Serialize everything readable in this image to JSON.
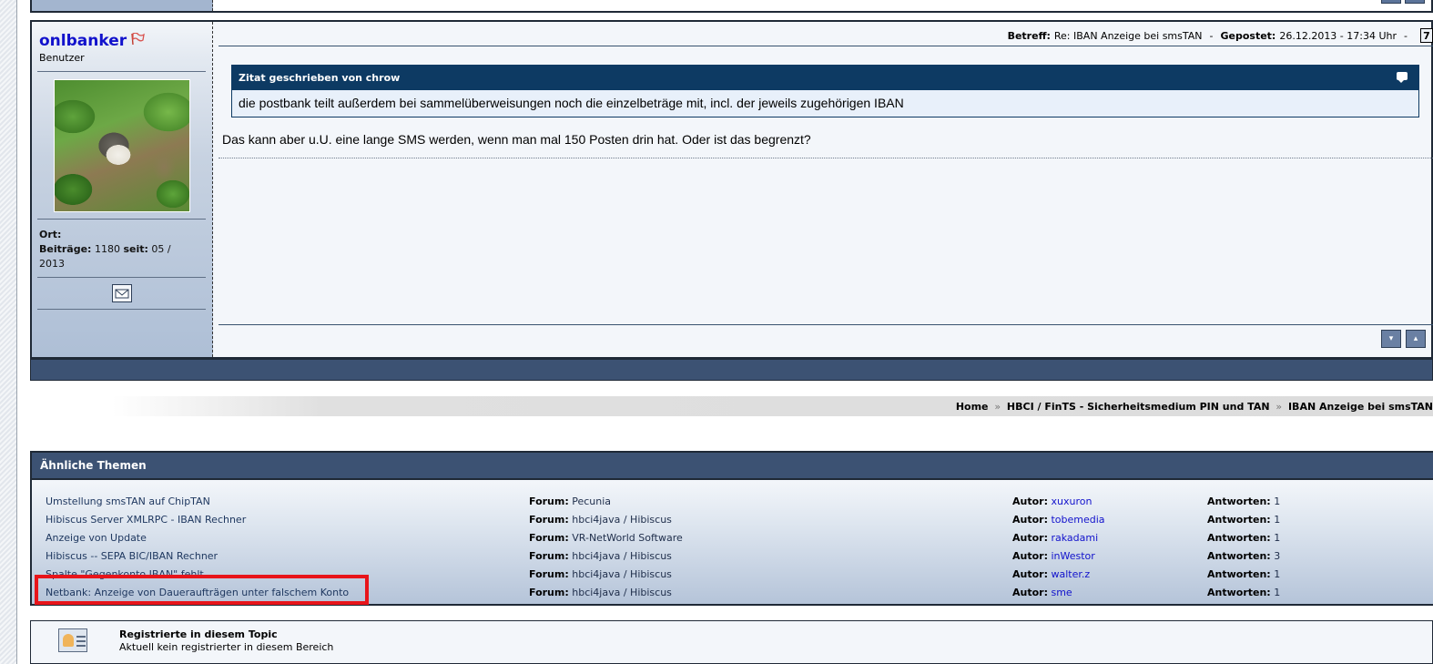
{
  "post": {
    "username": "onlbanker",
    "rank": "Benutzer",
    "ort_label": "Ort:",
    "ort_value": "",
    "beitraege_label": "Beiträge:",
    "beitraege_value": "1180",
    "seit_label": "seit:",
    "seit_value": "05 / 2013",
    "betreff_label": "Betreff:",
    "betreff_value": "Re: IBAN Anzeige bei smsTAN",
    "separator": "-",
    "gepostet_label": "Gepostet:",
    "gepostet_value": "26.12.2013 - 17:34 Uhr",
    "quote_button": "7",
    "quote_title": "Zitat geschrieben von chrow",
    "quote_text": "die postbank teilt außerdem bei sammelüberweisungen noch die einzelbeträge mit, incl. der jeweils zugehörigen IBAN",
    "body_text": "Das kann aber u.U. eine lange SMS werden, wenn man mal 150 Posten drin hat. Oder ist das begrenzt?",
    "icons": {
      "flag": "flag-icon",
      "email": "email-icon",
      "quote_bubble": "speech-bubble-icon",
      "nav_down": "arrow-down-icon",
      "nav_up": "arrow-up-icon"
    }
  },
  "breadcrumb": {
    "items": [
      "Home",
      "HBCI / FinTS - Sicherheitsmedium PIN und TAN",
      "IBAN Anzeige bei smsTAN"
    ],
    "separator": "»"
  },
  "similar": {
    "title": "Ähnliche Themen",
    "forum_label": "Forum:",
    "autor_label": "Autor:",
    "answers_label": "Antworten:",
    "rows": [
      {
        "topic": "Umstellung smsTAN auf ChipTAN",
        "forum": "Pecunia",
        "autor": "xuxuron",
        "answers": "1"
      },
      {
        "topic": "Hibiscus Server XMLRPC - IBAN Rechner",
        "forum": "hbci4java / Hibiscus",
        "autor": "tobemedia",
        "answers": "1"
      },
      {
        "topic": "Anzeige von Update",
        "forum": "VR-NetWorld Software",
        "autor": "rakadami",
        "answers": "1"
      },
      {
        "topic": "Hibiscus -- SEPA BIC/IBAN Rechner",
        "forum": "hbci4java / Hibiscus",
        "autor": "inWestor",
        "answers": "3"
      },
      {
        "topic": "Spalte \"Gegenkonto IBAN\" fehlt",
        "forum": "hbci4java / Hibiscus",
        "autor": "walter.z",
        "answers": "1"
      },
      {
        "topic": "Netbank: Anzeige von Daueraufträgen unter falschem Konto",
        "forum": "hbci4java / Hibiscus",
        "autor": "sme",
        "answers": "1"
      }
    ]
  },
  "registered": {
    "title": "Registrierte in diesem Topic",
    "text": "Aktuell kein registrierter in diesem Bereich",
    "icon": "users-icon"
  },
  "colors": {
    "header_blue": "#3c5273",
    "quote_blue": "#0d3a63",
    "link_blue": "#1212cc",
    "highlight_red": "#e8141a"
  }
}
